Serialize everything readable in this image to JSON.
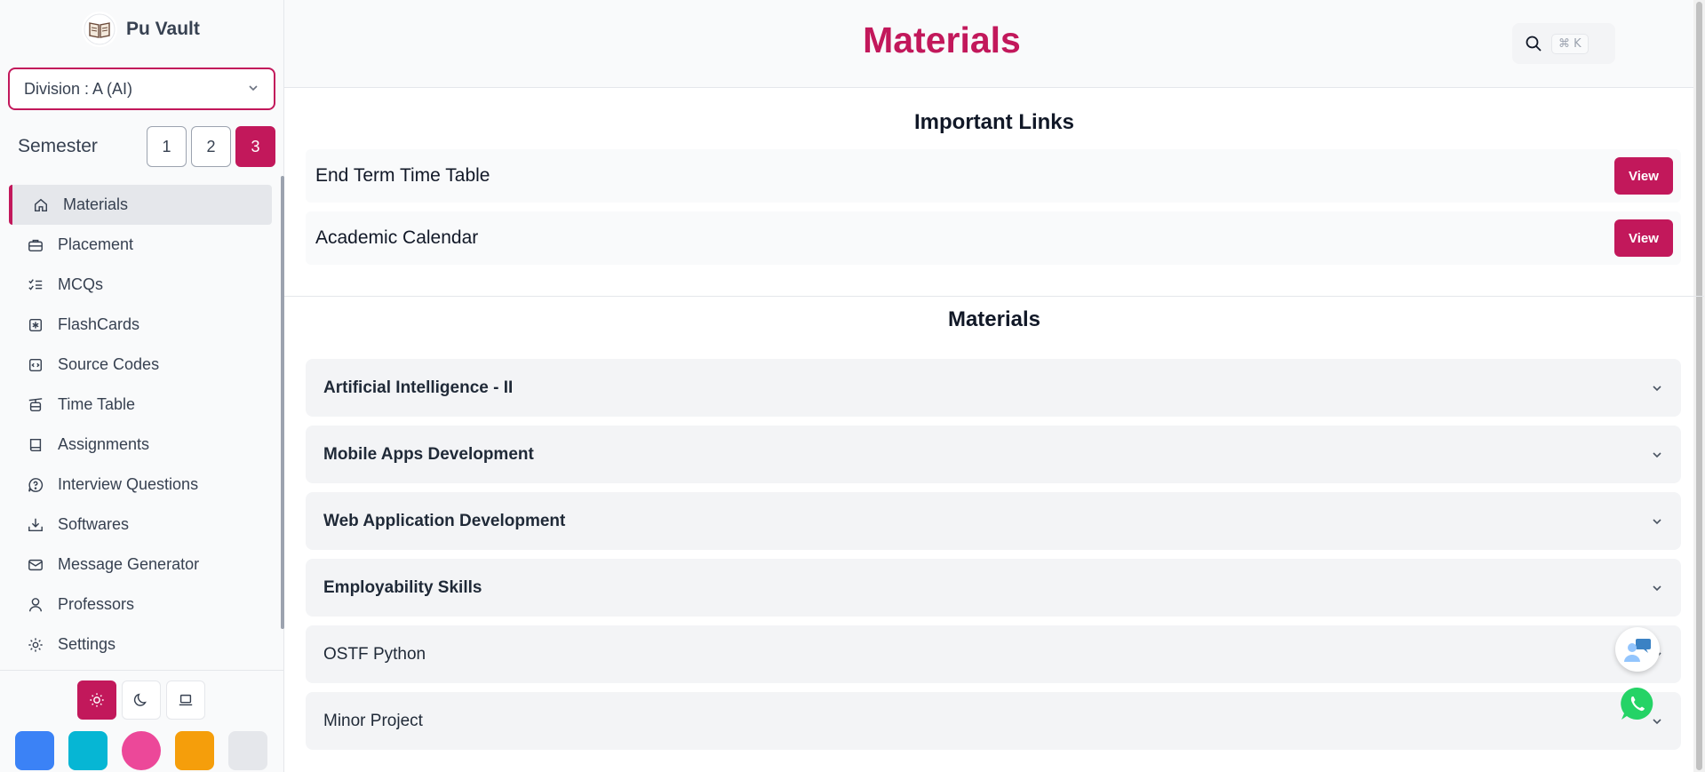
{
  "brand": {
    "name": "Pu Vault"
  },
  "division": {
    "value": "Division : A (AI)"
  },
  "semester": {
    "label": "Semester",
    "options": [
      "1",
      "2",
      "3"
    ],
    "selected": "3"
  },
  "nav": [
    {
      "label": "Materials",
      "icon": "home-icon",
      "active": true
    },
    {
      "label": "Placement",
      "icon": "briefcase-icon"
    },
    {
      "label": "MCQs",
      "icon": "list-checks-icon"
    },
    {
      "label": "FlashCards",
      "icon": "flashcard-icon"
    },
    {
      "label": "Source Codes",
      "icon": "code-file-icon"
    },
    {
      "label": "Time Table",
      "icon": "cable-car-icon"
    },
    {
      "label": "Assignments",
      "icon": "book-icon"
    },
    {
      "label": "Interview Questions",
      "icon": "help-bubble-icon"
    },
    {
      "label": "Softwares",
      "icon": "download-icon"
    },
    {
      "label": "Message Generator",
      "icon": "mail-icon"
    },
    {
      "label": "Professors",
      "icon": "user-icon"
    },
    {
      "label": "Settings",
      "icon": "gear-icon"
    }
  ],
  "theme": {
    "modes": [
      "light",
      "dark",
      "system"
    ],
    "selected": "light"
  },
  "accent_swatches": [
    "#3b82f6",
    "#06b6d4",
    "#ec4899",
    "#f59e0b",
    "#e5e7eb"
  ],
  "colors": {
    "accent": "#c2185b"
  },
  "header": {
    "title": "Materials",
    "search_shortcut": "⌘ K"
  },
  "important_links": {
    "heading": "Important Links",
    "items": [
      {
        "label": "End Term Time Table",
        "button": "View"
      },
      {
        "label": "Academic Calendar",
        "button": "View"
      }
    ]
  },
  "materials": {
    "heading": "Materials",
    "subjects": [
      "Artificial Intelligence - II",
      "Mobile Apps Development",
      "Web Application Development",
      "Employability Skills",
      "OSTF Python",
      "Minor Project"
    ]
  }
}
